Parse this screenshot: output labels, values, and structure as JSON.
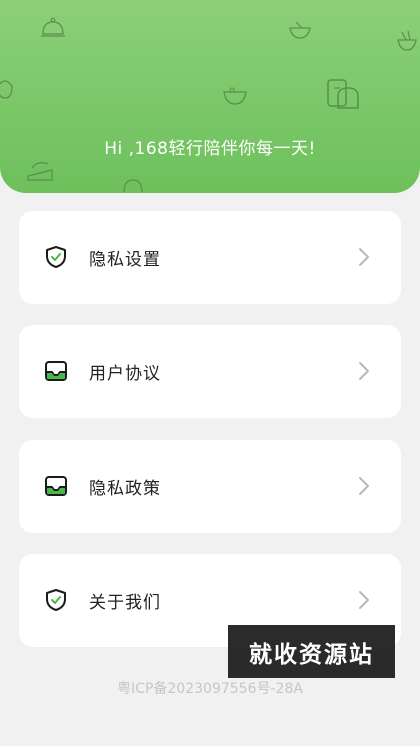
{
  "header": {
    "greeting": "Hi ,168轻行陪伴你每一天!",
    "background_color": "#7cc86a"
  },
  "menu": {
    "items": [
      {
        "label": "隐私设置",
        "icon": "shield-check-icon"
      },
      {
        "label": "用户协议",
        "icon": "mail-tray-icon"
      },
      {
        "label": "隐私政策",
        "icon": "mail-tray-icon"
      },
      {
        "label": "关于我们",
        "icon": "shield-check-icon"
      }
    ]
  },
  "footer": {
    "icp": "粤ICP备2023097556号-28A"
  },
  "watermark": {
    "text": "就收资源站"
  },
  "colors": {
    "accent_green": "#49b84a",
    "icon_dark": "#1a1a1a"
  }
}
